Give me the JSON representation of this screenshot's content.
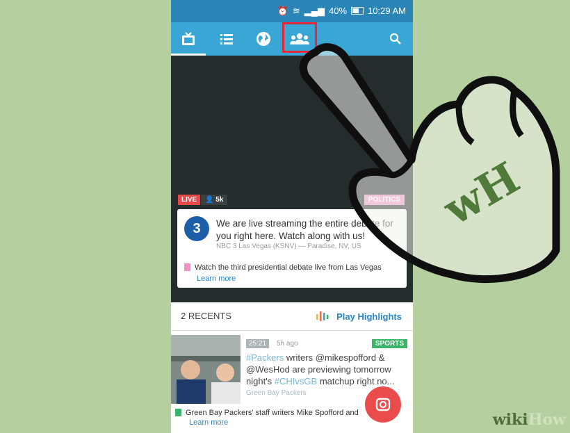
{
  "status_bar": {
    "battery": "40%",
    "time": "10:29 AM"
  },
  "nav": {
    "items": [
      "tv-icon",
      "list-icon",
      "globe-icon",
      "people-icon"
    ],
    "search": "search-icon",
    "highlight_color": "#e5293a"
  },
  "featured": {
    "live_label": "LIVE",
    "viewers": "5k",
    "category": "POLITICS",
    "station_logo": "3",
    "text": "We are live streaming the entire debate for you right here. Watch along with us!",
    "source": "NBC 3 Las Vegas (KSNV) — Paradise, NV, US",
    "note": "Watch the third presidential debate live from Las Vegas",
    "learn_more": "Learn more"
  },
  "recents": {
    "title": "2 RECENTS",
    "play_highlights": "Play Highlights",
    "item": {
      "duration": "25:21",
      "time_ago": "5h ago",
      "category": "SPORTS",
      "hashtag1": "#Packers",
      "text1": " writers @mikespofford & @WesHod are previewing tomorrow night's ",
      "hashtag2": "#CHIvsGB",
      "text2": " matchup right no...",
      "source": "Green Bay Packers",
      "note": "Green Bay Packers' staff writers Mike Spofford and",
      "learn_more": "Learn more"
    }
  },
  "watermark": {
    "wiki": "wiki",
    "how": "How"
  },
  "logo_overlay": "wH",
  "colors": {
    "nav": "#39a6d6",
    "status": "#2a86b6",
    "live": "#e94848",
    "politics": "#f090c6",
    "sports": "#3cb56a",
    "fab": "#ea4b4b",
    "background": "#b5cf9e"
  }
}
